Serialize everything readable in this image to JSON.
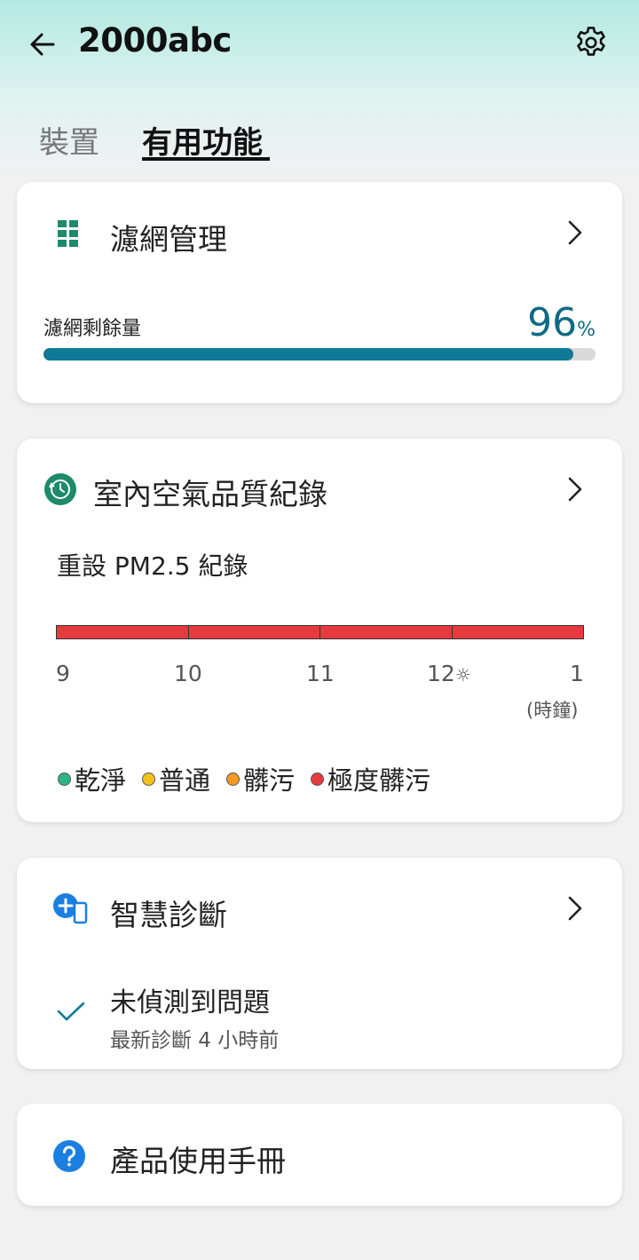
{
  "header": {
    "title": "2000abc",
    "back_icon": "arrow-left-icon",
    "settings_icon": "gear-icon"
  },
  "tabs": [
    {
      "label": "裝置",
      "active": false
    },
    {
      "label": "有用功能",
      "active": true
    }
  ],
  "filter_card": {
    "title": "濾網管理",
    "icon": "filter-grid-icon",
    "remaining_label": "濾網剩餘量",
    "remaining_value": "96",
    "remaining_unit": "%",
    "remaining_fraction": 0.96
  },
  "aqi_card": {
    "title": "室內空氣品質紀錄",
    "icon": "history-clock-icon",
    "reset_label": "重設 PM2.5 紀錄",
    "timeline_segments": [
      "very-dirty",
      "very-dirty",
      "very-dirty",
      "very-dirty"
    ],
    "ticks": [
      "9",
      "10",
      "11",
      "12",
      "1"
    ],
    "noon_marker": "☼",
    "unit": "(時鐘)",
    "legend": [
      {
        "label": "乾淨",
        "color": "#2db38a"
      },
      {
        "label": "普通",
        "color": "#f2c21b"
      },
      {
        "label": "髒污",
        "color": "#f29a22"
      },
      {
        "label": "極度髒污",
        "color": "#e63a3f"
      }
    ]
  },
  "diag_card": {
    "title": "智慧診斷",
    "icon": "device-plus-icon",
    "status": "未偵測到問題",
    "last_check": "最新診斷 4 小時前"
  },
  "manual_card": {
    "title": "產品使用手冊",
    "icon": "question-icon"
  },
  "colors": {
    "accent": "#0e7a96",
    "green_icon": "#1d8a6a",
    "blue_icon": "#1a7fe0",
    "very_dirty": "#e63a3f"
  }
}
